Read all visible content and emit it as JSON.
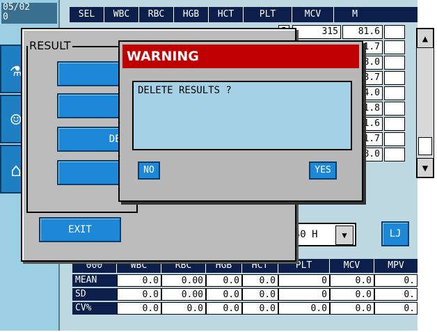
{
  "header": {
    "date": "05/02",
    "date_line2": "0"
  },
  "top_table": {
    "columns": [
      "SEL",
      "WBC",
      "RBC",
      "HGB",
      "HCT",
      "PLT",
      "MCV",
      "M"
    ],
    "row1": {
      "hct_partial": "5",
      "plt": "315",
      "mcv": "81.6"
    },
    "mcv_column": [
      "81.7",
      "88.0",
      "73.7",
      "74.0",
      "81.8",
      "81.6",
      "81.7",
      "88.0"
    ]
  },
  "scrollbar": {
    "up_icon": "▲",
    "down_icon": "▼"
  },
  "result_dialog": {
    "title": "RESULT",
    "delete_button": "DEL",
    "exit_button": "EXIT",
    "nav_right_icon": "▶"
  },
  "warning_dialog": {
    "title": "WARNING",
    "message": "DELETE RESULTS ?",
    "no_button": "NO",
    "yes_button": "YES"
  },
  "qc": {
    "file_select_value": "1640 H",
    "select_arrow_icon": "▼",
    "lj_button": "LJ",
    "columns": [
      "000",
      "WBC",
      "RBC",
      "HGB",
      "HCT",
      "PLT",
      "MCV",
      "MPV"
    ],
    "rows": [
      {
        "label": "MEAN",
        "values": [
          "0.0",
          "0.00",
          "0.0",
          "0.0",
          "0",
          "0.0",
          "0."
        ]
      },
      {
        "label": "SD",
        "values": [
          "0.0",
          "0.00",
          "0.0",
          "0.0",
          "0",
          "0.0",
          "0."
        ]
      },
      {
        "label": "CV%",
        "values": [
          "0.0",
          "0.0",
          "0.0",
          "0.0",
          "0.0",
          "0.0",
          "0."
        ]
      }
    ]
  },
  "colors": {
    "background": "#bfd9e3",
    "header_navy": "#0b1f4a",
    "button_blue": "#1e88d8",
    "warning_red": "#c00000",
    "dialog_gray": "#bcbcbc"
  }
}
